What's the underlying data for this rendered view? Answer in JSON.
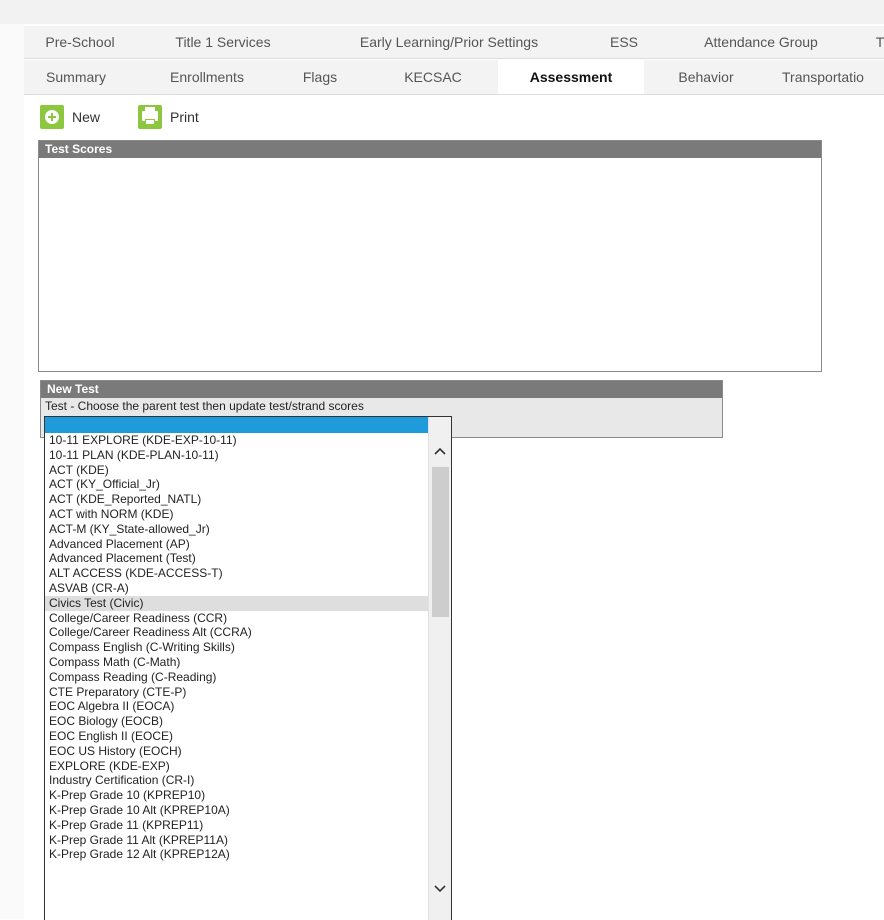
{
  "tabs_row1": [
    {
      "label": "Pre-School"
    },
    {
      "label": "Title 1 Services"
    },
    {
      "label": "Early Learning/Prior Settings"
    },
    {
      "label": "ESS"
    },
    {
      "label": "Attendance Group"
    },
    {
      "label": "T"
    }
  ],
  "tabs_row2": [
    {
      "label": "Summary"
    },
    {
      "label": "Enrollments"
    },
    {
      "label": "Flags"
    },
    {
      "label": "KECSAC"
    },
    {
      "label": "Assessment",
      "active": true
    },
    {
      "label": "Behavior"
    },
    {
      "label": "Transportatio"
    }
  ],
  "toolbar": {
    "new_label": "New",
    "new_icon": "plus-circle-icon",
    "print_label": "Print",
    "print_icon": "printer-icon",
    "icon_color": "#8dc63f"
  },
  "test_scores": {
    "title": "Test Scores"
  },
  "new_test": {
    "title": "New Test",
    "field_label": "Test - Choose the parent test then update test/strand scores",
    "selected_value": "",
    "options": [
      "",
      "10-11 EXPLORE (KDE-EXP-10-11)",
      "10-11 PLAN (KDE-PLAN-10-11)",
      "ACT (KDE)",
      "ACT (KY_Official_Jr)",
      "ACT (KDE_Reported_NATL)",
      "ACT with NORM (KDE)",
      "ACT-M (KY_State-allowed_Jr)",
      "Advanced Placement (AP)",
      "Advanced Placement (Test)",
      "ALT ACCESS (KDE-ACCESS-T)",
      "ASVAB (CR-A)",
      "Civics Test (Civic)",
      "College/Career Readiness (CCR)",
      "College/Career Readiness Alt (CCRA)",
      "Compass English (C-Writing Skills)",
      "Compass Math (C-Math)",
      "Compass Reading (C-Reading)",
      "CTE Preparatory (CTE-P)",
      "EOC Algebra II (EOCA)",
      "EOC Biology (EOCB)",
      "EOC English II (EOCE)",
      "EOC US History (EOCH)",
      "EXPLORE (KDE-EXP)",
      "Industry Certification (CR-I)",
      "K-Prep Grade 10 (KPREP10)",
      "K-Prep Grade 10 Alt (KPREP10A)",
      "K-Prep Grade 11 (KPREP11)",
      "K-Prep Grade 11 Alt (KPREP11A)",
      "K-Prep Grade 12 Alt (KPREP12A)"
    ],
    "hover_index": 12,
    "selection_color": "#1f9bdb",
    "hover_color": "#dedede"
  }
}
